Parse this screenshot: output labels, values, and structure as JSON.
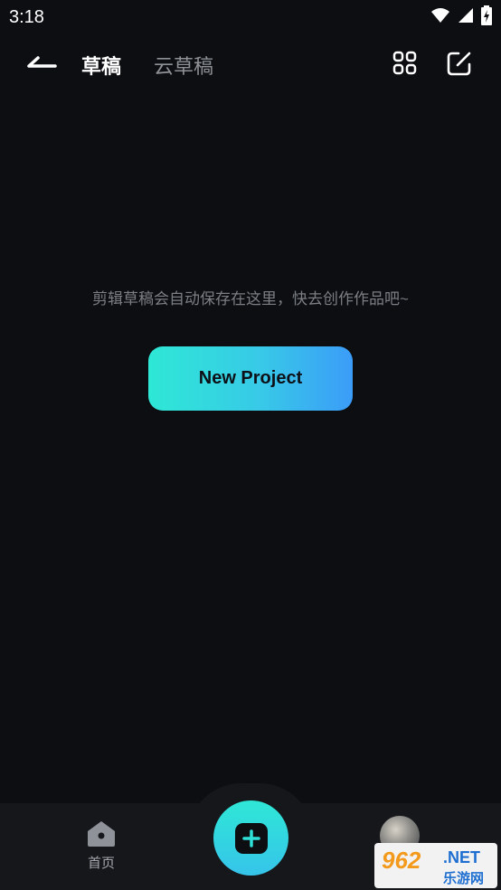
{
  "status": {
    "time": "3:18"
  },
  "header": {
    "tabs": [
      {
        "label": "草稿",
        "active": true
      },
      {
        "label": "云草稿",
        "active": false
      }
    ],
    "icons": [
      "back-icon",
      "grid-icon",
      "edit-icon"
    ]
  },
  "main": {
    "empty_message": "剪辑草稿会自动保存在这里，快去创作作品吧~",
    "new_project_label": "New Project"
  },
  "bottom_nav": {
    "home_label": "首页"
  },
  "watermark": {
    "number": "962",
    "net": ".NET",
    "cn": "乐游网"
  },
  "colors": {
    "background": "#0c0e12",
    "accent_start": "#2ee8d5",
    "accent_end": "#3b9cf8",
    "text_secondary": "#7b7e83"
  }
}
